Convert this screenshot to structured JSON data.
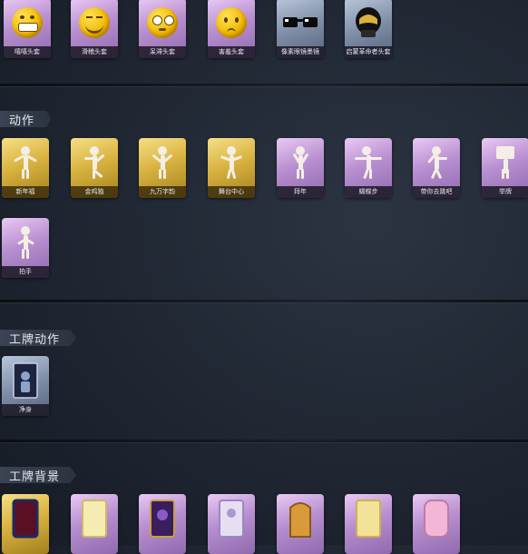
{
  "sections": {
    "heads": {
      "items": [
        {
          "label": "嘻嘻头套"
        },
        {
          "label": "滑稽头套"
        },
        {
          "label": "呆滞头套"
        },
        {
          "label": "害羞头套"
        },
        {
          "label": "像素眼镜墨镜"
        },
        {
          "label": "启蒙革命者头套"
        }
      ]
    },
    "actions": {
      "title": "动作",
      "items": [
        {
          "label": "新年福"
        },
        {
          "label": "金鸡独"
        },
        {
          "label": "九万字韵"
        },
        {
          "label": "舞台中心"
        },
        {
          "label": "拜年"
        },
        {
          "label": "蝴蝶步"
        },
        {
          "label": "带你去跳吧"
        },
        {
          "label": "举牌"
        },
        {
          "label": "拍手"
        }
      ]
    },
    "badge_actions": {
      "title": "工牌动作",
      "items": [
        {
          "label": "净身"
        }
      ]
    },
    "badge_backgrounds": {
      "title": "工牌背景",
      "items": []
    }
  },
  "colors": {
    "purple_card": "#b88fd0",
    "gold_card": "#d9b340",
    "header_pin": "#c0303a",
    "background": "#1f2632"
  }
}
